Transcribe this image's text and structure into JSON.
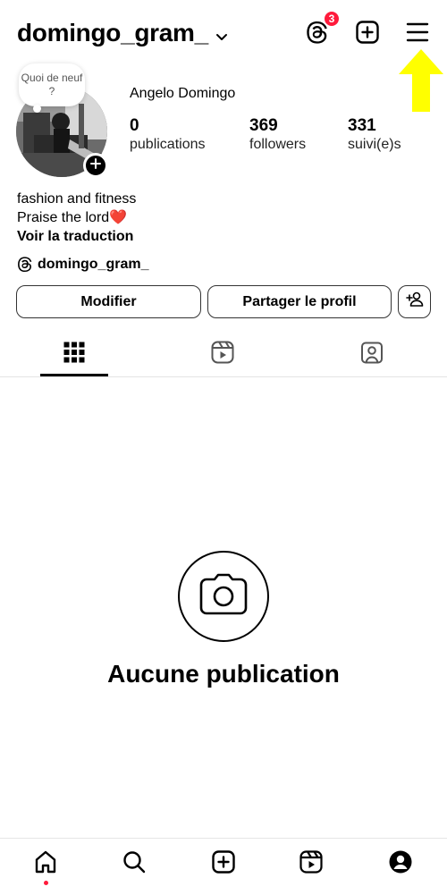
{
  "header": {
    "username": "domingo_gram_",
    "threads_badge_count": "3"
  },
  "note": {
    "text": "Quoi de neuf ?"
  },
  "profile": {
    "full_name": "Angelo Domingo",
    "stats": [
      {
        "value": "0",
        "label": "publications"
      },
      {
        "value": "369",
        "label": "followers"
      },
      {
        "value": "331",
        "label": "suivi(e)s"
      }
    ],
    "bio_line1": "fashion and fitness",
    "bio_line2": "Praise the lord",
    "bio_emoji": "❤️",
    "translate_label": "Voir la traduction",
    "threads_handle": "domingo_gram_"
  },
  "actions": {
    "edit_label": "Modifier",
    "share_label": "Partager le profil"
  },
  "empty_state": {
    "title": "Aucune publication"
  },
  "colors": {
    "badge": "#ff1a3b",
    "highlight_arrow": "#ffff00"
  },
  "icons": {
    "top": [
      "threads-icon",
      "new-post-icon",
      "menu-icon"
    ],
    "tabs": [
      "grid-icon",
      "reels-icon",
      "tagged-icon"
    ],
    "nav": [
      "home-icon",
      "search-icon",
      "create-icon",
      "reels-icon",
      "profile-icon"
    ]
  }
}
